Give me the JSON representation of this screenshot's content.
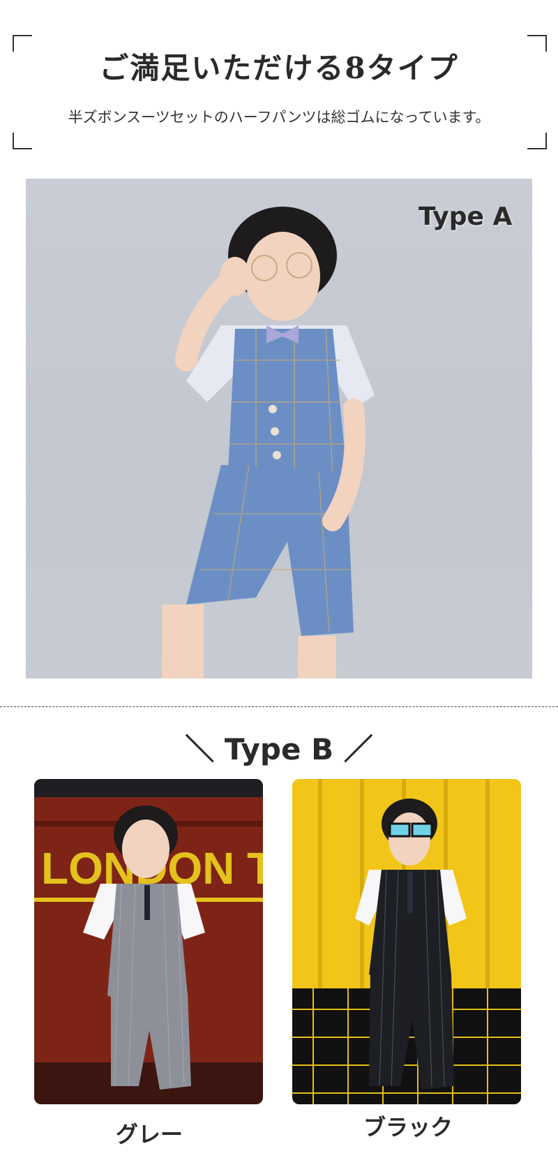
{
  "header": {
    "title": "ご満足いただける8タイプ",
    "subtitle": "半ズボンスーツセットのハーフパンツは総ゴムになっています。"
  },
  "type_a": {
    "label": "Type A"
  },
  "type_b": {
    "label": "＼ Type B ／",
    "variants": [
      {
        "caption": "グレー"
      },
      {
        "caption": "ブラック"
      }
    ]
  },
  "photo_texts": {
    "gray_background_sign": "LONDON TI"
  },
  "colors": {
    "suit_blue": "#6b8fc4",
    "photo_a_background": "#c8ccd3",
    "gray_variant_background": "#7a2216",
    "black_variant_background": "#f0c419"
  }
}
